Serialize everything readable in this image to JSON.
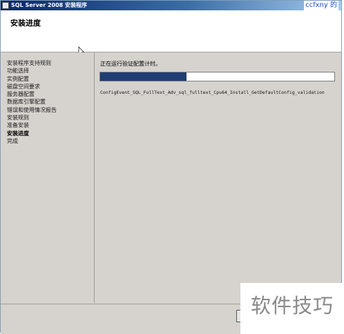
{
  "window": {
    "title": "SQL Server 2008 安装程序",
    "brand_watermark": "ccfxny 的"
  },
  "header": {
    "page_title": "安装进度"
  },
  "sidebar": {
    "items": [
      {
        "label": "安装程序支持规则",
        "active": false
      },
      {
        "label": "功能选择",
        "active": false
      },
      {
        "label": "实例配置",
        "active": false
      },
      {
        "label": "磁盘空间要求",
        "active": false
      },
      {
        "label": "服务器配置",
        "active": false
      },
      {
        "label": "数据库引擎配置",
        "active": false
      },
      {
        "label": "错误和使用情况报告",
        "active": false
      },
      {
        "label": "安装规则",
        "active": false
      },
      {
        "label": "准备安装",
        "active": false
      },
      {
        "label": "安装进度",
        "active": true
      },
      {
        "label": "完成",
        "active": false
      }
    ]
  },
  "main": {
    "status_text": "正在运行验证配置计时。",
    "progress_fraction": 0.37,
    "progress_color": "#1f3d73",
    "log_text": "ConfigEvent_SQL_FullText_Adv_sql_fulltext_Cpu64_Install_GetDefaultConfig_validation"
  },
  "footer": {
    "watermark_text": "软件技巧"
  }
}
